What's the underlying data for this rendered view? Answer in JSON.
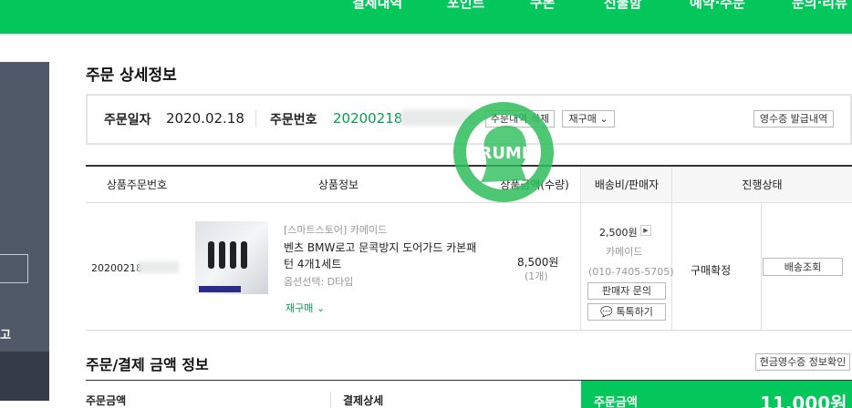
{
  "topnav": {
    "items": [
      "결제내역",
      "포인트",
      "쿠폰",
      "선물함",
      "예약·주문",
      "문의·리뷰"
    ]
  },
  "sidebar": {
    "text": "고"
  },
  "order_detail": {
    "title": "주문 상세정보",
    "date_label": "주문일자",
    "date_value": "2020.02.18",
    "number_label": "주문번호",
    "number_value": "20200218",
    "delete_button": "주문내역 삭제",
    "reorder_button": "재구매",
    "receipt_button": "영수증 발급내역"
  },
  "table": {
    "headers": [
      "상품주문번호",
      "상품정보",
      "상품금액(수량)",
      "배송비/판매자",
      "진행상태"
    ],
    "row": {
      "order_no": "20200218",
      "store": "[스마트스토어] 카메이드",
      "name_line1": "벤츠 BMW로고 문콕방지 도어가드 카본패",
      "name_line2": "턴 4개1세트",
      "option": "옵션선택: D타입",
      "reorder": "재구매",
      "price": "8,500원",
      "quantity": "(1개)",
      "shipping_fee": "2,500원",
      "seller": "카메이드",
      "seller_phone": "(010-7405-5705)",
      "seller_inquiry": "판매자 문의",
      "talk": "톡톡하기",
      "status": "구매확정",
      "track_button": "배송조회"
    }
  },
  "payment": {
    "title": "주문/결제 금액 정보",
    "cash_receipt_button": "현금영수증 정보확인",
    "order_amount_label": "주문금액",
    "payment_detail_label": "결제상세",
    "total_label": "주문금액",
    "total_value": "11,000원"
  },
  "colors": {
    "brand_green": "#03c75a"
  },
  "watermark_text": "RUMI"
}
